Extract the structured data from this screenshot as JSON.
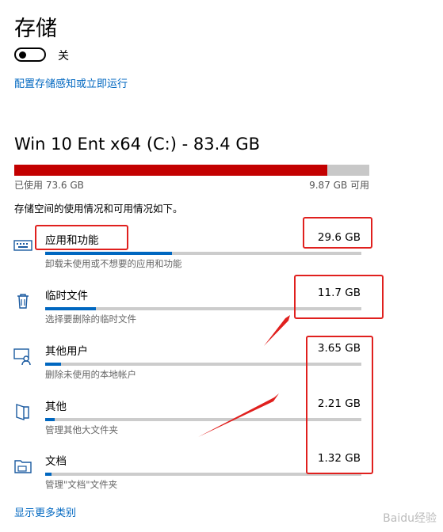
{
  "page": {
    "title": "存储",
    "toggle_state_label": "关",
    "config_link": "配置存储感知或立即运行",
    "drive_title": "Win 10 Ent x64 (C:) - 83.4 GB",
    "used_label": "已使用 73.6 GB",
    "free_label": "9.87 GB 可用",
    "used_fraction": 0.882,
    "description": "存储空间的使用情况和可用情况如下。",
    "more_link": "显示更多类别"
  },
  "categories": [
    {
      "name": "应用和功能",
      "size": "29.6 GB",
      "subtitle": "卸载未使用或不想要的应用和功能",
      "fraction": 0.4,
      "icon": "keyboard-icon"
    },
    {
      "name": "临时文件",
      "size": "11.7 GB",
      "subtitle": "选择要删除的临时文件",
      "fraction": 0.16,
      "icon": "trash-icon"
    },
    {
      "name": "其他用户",
      "size": "3.65 GB",
      "subtitle": "删除未使用的本地帐户",
      "fraction": 0.05,
      "icon": "user-monitor-icon"
    },
    {
      "name": "其他",
      "size": "2.21 GB",
      "subtitle": "管理其他大文件夹",
      "fraction": 0.03,
      "icon": "document-icon"
    },
    {
      "name": "文档",
      "size": "1.32 GB",
      "subtitle": "管理\"文档\"文件夹",
      "fraction": 0.02,
      "icon": "folder-icon"
    }
  ],
  "watermark": {
    "text": "Baidu经验"
  },
  "colors": {
    "accent": "#0067c0",
    "usage_red": "#c30000",
    "annotation_red": "#e0201e"
  }
}
